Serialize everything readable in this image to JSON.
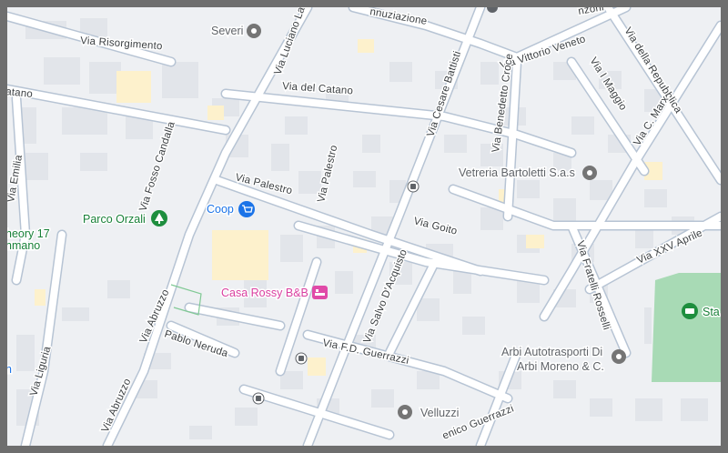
{
  "colors": {
    "background": "#eef0f3",
    "road": "#ffffff",
    "road_outline": "#b7c4d4",
    "building": "#e2e5ea",
    "building_highlight": "#fdf1cc",
    "park": "#a8dab5",
    "frame": "#6e6e6e",
    "shop_pin": "#1a73e8",
    "hotel_pin": "#e04aa8",
    "park_pin": "#1e8e3e",
    "generic_pin": "#757575"
  },
  "streets": [
    {
      "id": "via-risorgimento",
      "label": "Via Risorgimento"
    },
    {
      "id": "via-luciano-lama",
      "label": "Via Luciano La"
    },
    {
      "id": "via-del-catano",
      "label": "Via del Catano"
    },
    {
      "id": "catano-west",
      "label": "atano"
    },
    {
      "id": "via-cesare-battisti",
      "label": "Via Cesare Battisti"
    },
    {
      "id": "via-vittorio-veneto",
      "label": "Via Vittorio Veneto"
    },
    {
      "id": "via-della-repubblica",
      "label": "Via della Repubblica"
    },
    {
      "id": "via-i-maggio",
      "label": "Via I Maggio"
    },
    {
      "id": "via-c-marx",
      "label": "Via C. Marx"
    },
    {
      "id": "via-benedetto-croce",
      "label": "Via Benedetto Croce"
    },
    {
      "id": "via-emilia",
      "label": "Via Emilia"
    },
    {
      "id": "via-fosso-candalla",
      "label": "Via Fosso Candalla"
    },
    {
      "id": "via-palestro-h",
      "label": "Via Palestro"
    },
    {
      "id": "via-palestro-d",
      "label": "Via Palestro"
    },
    {
      "id": "via-goito",
      "label": "Via Goito"
    },
    {
      "id": "via-xxv-aprile",
      "label": "Via XXV Aprile"
    },
    {
      "id": "via-fratelli-rosselli",
      "label": "Via Fratelli Rosselli"
    },
    {
      "id": "via-salvo-dacquisto",
      "label": "Via Salvo D'Acquisto"
    },
    {
      "id": "via-abruzzo-1",
      "label": "Via Abruzzo"
    },
    {
      "id": "via-abruzzo-2",
      "label": "Via Abruzzo"
    },
    {
      "id": "pablo-neruda",
      "label": "Pablo Neruda"
    },
    {
      "id": "via-fd-guerrazzi",
      "label": "Via F.D. Guerrazzi"
    },
    {
      "id": "domenico-guerrazzi",
      "label": "enico Guerrazzi"
    },
    {
      "id": "via-liguria",
      "label": "Via Liguria"
    },
    {
      "id": "annunziazione",
      "label": "nnuziazione"
    },
    {
      "id": "manzoni",
      "label": "nzoni"
    }
  ],
  "pois": [
    {
      "id": "severi",
      "label": "Severi",
      "icon": "generic-pin"
    },
    {
      "id": "coop",
      "label": "Coop",
      "icon": "shopping-cart"
    },
    {
      "id": "parco-orzali",
      "label": "Parco Orzali",
      "icon": "tree"
    },
    {
      "id": "casa-rossy",
      "label": "Casa Rossy B&B",
      "icon": "bed"
    },
    {
      "id": "vetreria",
      "label": "Vetreria Bartoletti S.a.s",
      "icon": "generic-pin"
    },
    {
      "id": "arbi-1",
      "label": "Arbi Autotrasporti Di",
      "icon": "generic-pin"
    },
    {
      "id": "arbi-2",
      "label": "Arbi Moreno & C.",
      "icon": "generic-pin"
    },
    {
      "id": "velluzzi",
      "label": "Velluzzi",
      "icon": "generic-pin"
    },
    {
      "id": "stadium",
      "label": "Sta",
      "icon": "stadium"
    },
    {
      "id": "theory-1",
      "label": "heory 17"
    },
    {
      "id": "theory-2",
      "label": "nmano"
    },
    {
      "id": "edge-n",
      "label": "n"
    }
  ]
}
